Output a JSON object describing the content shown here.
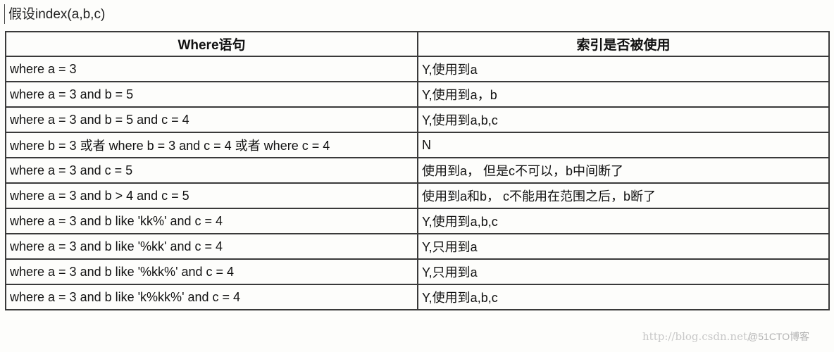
{
  "caption": "假设index(a,b,c)",
  "table": {
    "headers": [
      "Where语句",
      "索引是否被使用"
    ],
    "rows": [
      [
        "where a = 3",
        "Y,使用到a"
      ],
      [
        "where a = 3 and b = 5",
        "Y,使用到a，b"
      ],
      [
        "where a = 3 and b = 5 and c = 4",
        "Y,使用到a,b,c"
      ],
      [
        "where b = 3 或者 where b = 3 and c = 4  或者 where c = 4",
        "N"
      ],
      [
        "where a = 3 and c = 5",
        "使用到a， 但是c不可以，b中间断了"
      ],
      [
        "where a = 3 and b > 4 and c = 5",
        "使用到a和b， c不能用在范围之后，b断了"
      ],
      [
        "where a = 3 and b like 'kk%' and c = 4",
        "Y,使用到a,b,c"
      ],
      [
        "where a = 3 and b like '%kk' and c = 4",
        "Y,只用到a"
      ],
      [
        "where a = 3 and b like '%kk%' and c = 4",
        "Y,只用到a"
      ],
      [
        "where a = 3 and b like 'k%kk%' and c = 4",
        "Y,使用到a,b,c"
      ]
    ]
  },
  "watermark": {
    "url": "http://blog.csdn.net/",
    "brand": "@51CTO博客"
  }
}
